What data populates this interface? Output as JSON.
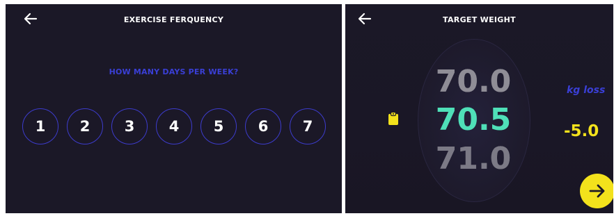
{
  "left": {
    "title": "EXERCISE FERQUENCY",
    "question": "HOW MANY DAYS PER WEEK?",
    "days": [
      "1",
      "2",
      "3",
      "4",
      "5",
      "6",
      "7"
    ],
    "back_icon": "arrow-left-icon"
  },
  "right": {
    "title": "TARGET WEIGHT",
    "back_icon": "arrow-left-icon",
    "picker": {
      "previous": "70.0",
      "selected": "70.5",
      "next": "71.0"
    },
    "unit_label": "kg loss",
    "difference": "-5.0",
    "clipboard_icon": "clipboard-icon",
    "next_icon": "arrow-right-icon"
  },
  "colors": {
    "background": "#1b1827",
    "accent_blue": "#3a3fd6",
    "accent_yellow": "#f3e21c",
    "accent_teal": "#4fe0b8"
  }
}
